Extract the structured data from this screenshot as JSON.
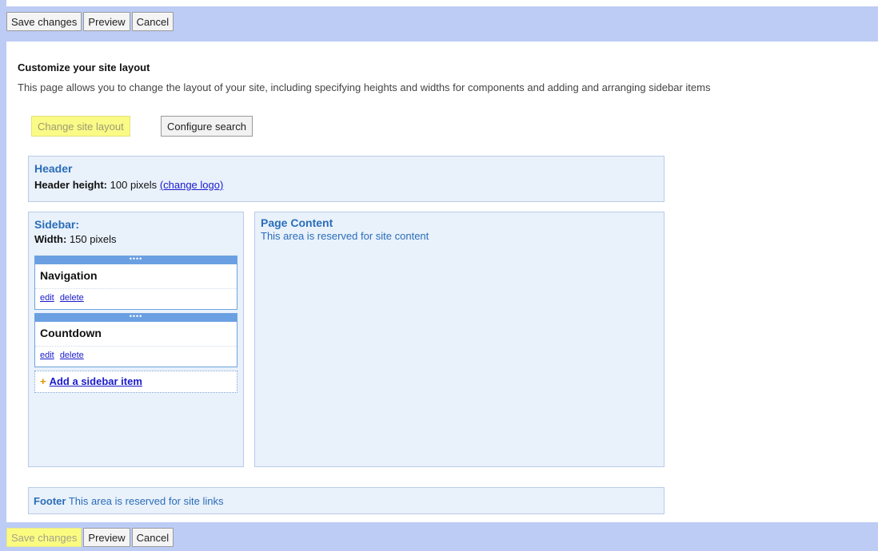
{
  "toolbar": {
    "save_label": "Save changes",
    "preview_label": "Preview",
    "cancel_label": "Cancel"
  },
  "page": {
    "title": "Customize your site layout",
    "description": "This page allows you to change the layout of your site, including specifying heights and widths for components and adding and arranging sidebar items"
  },
  "tabs": {
    "change_layout": "Change site layout",
    "configure_search": "Configure search"
  },
  "header": {
    "title": "Header",
    "height_label": "Header height:",
    "height_value": "100 pixels",
    "change_logo": "(change logo)"
  },
  "sidebar": {
    "title": "Sidebar:",
    "width_label": "Width:",
    "width_value": "150 pixels",
    "grip": "••••",
    "items": [
      {
        "title": "Navigation",
        "edit": "edit",
        "delete": "delete"
      },
      {
        "title": "Countdown",
        "edit": "edit",
        "delete": "delete"
      }
    ],
    "add_plus": "+",
    "add_label": "Add a sidebar item"
  },
  "content": {
    "title": "Page Content",
    "subtitle": "This area is reserved for site content"
  },
  "footer": {
    "label": "Footer",
    "text": "This area is reserved for site links"
  },
  "colors": {
    "toolbar_bg": "#bcccf4",
    "highlight": "#fbfb80",
    "panel_bg": "#e9f1fb",
    "accent": "#2a6db8"
  }
}
